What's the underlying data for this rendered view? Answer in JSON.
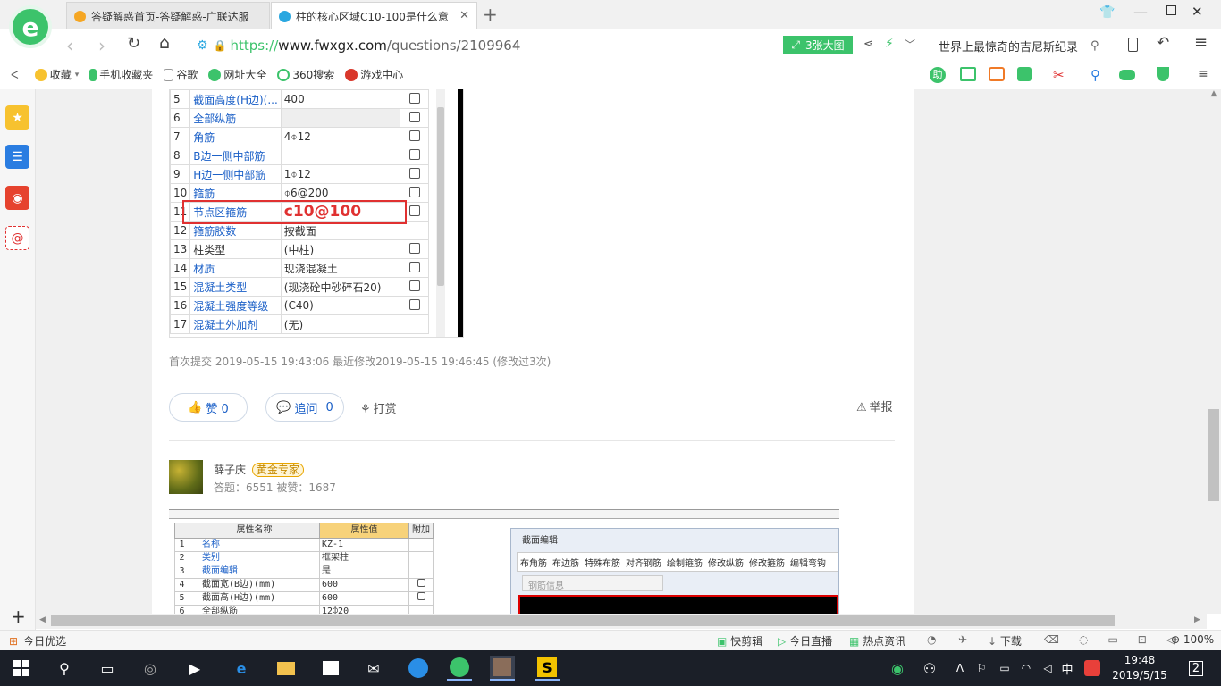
{
  "tabs": [
    {
      "title": "答疑解惑首页-答疑解惑-广联达服"
    },
    {
      "title": "柱的核心区域C10-100是什么意"
    }
  ],
  "address": {
    "protocol": "https://",
    "domain": "www.fwxgx.com",
    "path": "/questions/2109964"
  },
  "toolbar": {
    "big_image_label": "3张大图",
    "search_text": "世界上最惊奇的吉尼斯纪录"
  },
  "bookmarks": [
    "收藏",
    "手机收藏夹",
    "谷歌",
    "网址大全",
    "360搜索",
    "游戏中心"
  ],
  "colors": {
    "accent_green": "#3cc36b",
    "link_blue": "#1a5fc7",
    "highlight_red": "#e03131",
    "gold_badge": "#e8a500"
  },
  "prop_table": {
    "rows": [
      {
        "num": "5",
        "name": "截面高度(H边)(...",
        "value": "400",
        "blue": true,
        "check": true
      },
      {
        "num": "6",
        "name": "全部纵筋",
        "value": "",
        "blue": true,
        "check": true
      },
      {
        "num": "7",
        "name": "角筋",
        "value": "4⌽12",
        "blue": true,
        "check": true
      },
      {
        "num": "8",
        "name": "B边一侧中部筋",
        "value": "",
        "blue": true,
        "check": true
      },
      {
        "num": "9",
        "name": "H边一侧中部筋",
        "value": "1⌽12",
        "blue": true,
        "check": true
      },
      {
        "num": "10",
        "name": "箍筋",
        "value": "⌽6@200",
        "blue": true,
        "check": true
      },
      {
        "num": "11",
        "name": "节点区箍筋",
        "value": "c10@100",
        "blue": true,
        "check": true
      },
      {
        "num": "12",
        "name": "箍筋胶数",
        "value": "按截面",
        "blue": true,
        "check": false
      },
      {
        "num": "13",
        "name": "柱类型",
        "value": "(中柱)",
        "blue": false,
        "check": true
      },
      {
        "num": "14",
        "name": "材质",
        "value": "现浇混凝土",
        "blue": true,
        "check": true
      },
      {
        "num": "15",
        "name": "混凝土类型",
        "value": "(现浇砼中砂碎石20)",
        "blue": true,
        "check": true
      },
      {
        "num": "16",
        "name": "混凝土强度等级",
        "value": "(C40)",
        "blue": true,
        "check": true
      },
      {
        "num": "17",
        "name": "混凝土外加剂",
        "value": "(无)",
        "blue": true,
        "check": false
      }
    ]
  },
  "question_meta": "首次提交 2019-05-15 19:43:06   最近修改2019-05-15 19:46:45 (修改过3次)",
  "actions": {
    "like": "赞 0",
    "followup": "追问",
    "followup_count": "0",
    "reward": "打赏",
    "report": "举报"
  },
  "answer": {
    "user": "薛子庆",
    "badge": "黄金专家",
    "stats": "答题：6551    被赞：1687",
    "table_headers": [
      "属性名称",
      "属性值",
      "附加"
    ],
    "table_rows": [
      {
        "num": "1",
        "name": "名称",
        "value": "KZ-1"
      },
      {
        "num": "2",
        "name": "类别",
        "value": "框架柱"
      },
      {
        "num": "3",
        "name": "截面编辑",
        "value": "是"
      },
      {
        "num": "4",
        "name": "截面宽(B边)(mm)",
        "value": "600"
      },
      {
        "num": "5",
        "name": "截面高(H边)(mm)",
        "value": "600"
      },
      {
        "num": "6",
        "name": "全部纵筋",
        "value": "12⌽20"
      }
    ],
    "section_title": "截面编辑",
    "section_tools": [
      "布角筋",
      "布边筋",
      "特殊布筋",
      "对齐钢筋",
      "绘制箍筋",
      "修改纵筋",
      "修改箍筋",
      "编辑弯钩"
    ],
    "rebar_info": "钢筋信息"
  },
  "status": {
    "left": "今日优选",
    "items": [
      "快剪辑",
      "今日直播",
      "热点资讯",
      "下载"
    ],
    "zoom": "100%"
  },
  "taskbar": {
    "time": "19:48",
    "date": "2019/5/15",
    "ime": "中",
    "notif": "2"
  }
}
